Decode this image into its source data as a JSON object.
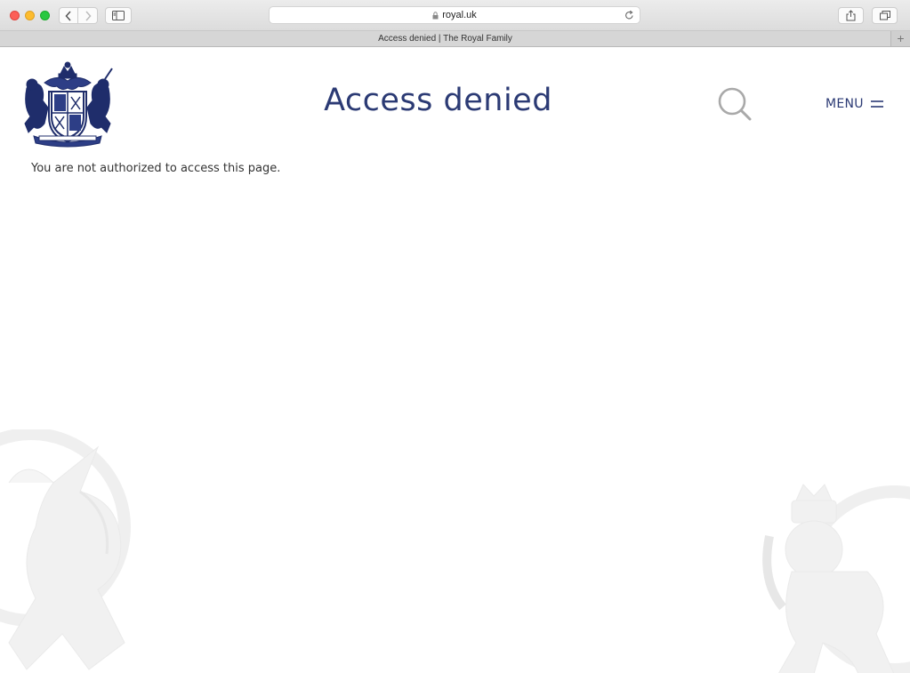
{
  "browser": {
    "url": "royal.uk",
    "tab_title": "Access denied | The Royal Family",
    "new_tab_symbol": "+"
  },
  "site": {
    "title": "Access denied",
    "menu_label": "MENU",
    "message": "You are not authorized to access this page.",
    "brand_color": "#2b3a74",
    "icons": [
      "coat-of-arms",
      "search-icon",
      "hamburger-icon"
    ]
  }
}
